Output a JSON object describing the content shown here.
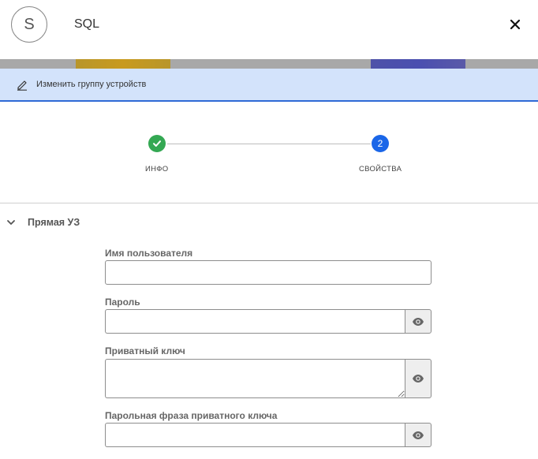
{
  "header": {
    "avatar_letter": "S",
    "title": "SQL"
  },
  "edit_bar": {
    "label": "Изменить группу устройств"
  },
  "stepper": {
    "steps": [
      {
        "label": "ИНФО",
        "state": "completed"
      },
      {
        "label": "СВОЙСТВА",
        "number": "2",
        "state": "active"
      }
    ]
  },
  "section": {
    "title": "Прямая УЗ",
    "fields": [
      {
        "label": "Имя пользователя",
        "value": ""
      },
      {
        "label": "Пароль",
        "value": ""
      },
      {
        "label": "Приватный ключ",
        "value": ""
      },
      {
        "label": "Парольная фраза приватного ключа",
        "value": ""
      }
    ]
  },
  "colors": {
    "accent": "#1a66e8",
    "success": "#34a853",
    "edit_bar_bg": "#d3e3fb"
  },
  "icons": {
    "close": "close-icon",
    "edit": "pencil-icon",
    "check": "check-icon",
    "chevron": "chevron-down-icon",
    "reveal": "eye-icon"
  }
}
